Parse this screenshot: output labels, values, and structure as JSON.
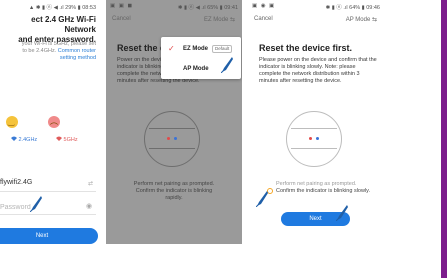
{
  "colors": {
    "accent": "#1f7ae0",
    "side_strip": "#7c1d8c",
    "pen": "#1f5fa8",
    "check": "#e04a4a"
  },
  "screen1": {
    "status_right": "▲ ✱ ▮ ⓝ ◀ .ıl 29% ▮ 08:53",
    "title_line1": "ect 2.4 GHz Wi-Fi Network",
    "title_line2": "and enter password.",
    "note_line1": "your Wi-Fi is 5GHz, please set",
    "note_line2": "to be 2.4GHz.",
    "note_link": "Common router",
    "note_link2": "setting method",
    "band_24": "2.4GHz",
    "band_5": "5GHz",
    "ssid": "flywifi2.4G",
    "ssid_arrow": "⇄",
    "password_placeholder": "Password",
    "next_label": "Next"
  },
  "screen2": {
    "status_left": "▣ ▣ ◼",
    "status_right": "✱ ▮ ⓝ ◀ .ıl 65% ▮ 09:41",
    "cancel_label": "Cancel",
    "mode_label": "EZ Mode ⇆",
    "title": "Reset the devic",
    "body": "Power on the device and confirm that the indicator is blinking rapidly. Note: please complete the network distribution within 3 minutes after resetting the device.",
    "footer_line1": "Perform net pairing as prompted.",
    "footer_line2": "Confirm the indicator is blinking",
    "footer_line3": "rapidly.",
    "menu": {
      "ez_mode": "EZ Mode",
      "default_tag": "Default",
      "ap_mode": "AP Mode",
      "check_icon": "checkmark-icon"
    }
  },
  "screen3": {
    "status_left": "▣ ◉ ▣",
    "status_right": "✱ ▮ ⓝ .ıl 64% ▮ 09:46",
    "cancel_label": "Cancel",
    "mode_label": "AP Mode ⇆",
    "title": "Reset the device first.",
    "body": "Please power on the device and confirm that the indicator is blinking slowly. Note: please complete the network distribution within 3 minutes after resetting the device.",
    "footer_line1": "Perform net pairing as prompted.",
    "footer_line2": "Confirm the indicator is blinking slowly.",
    "next_label": "Next"
  }
}
